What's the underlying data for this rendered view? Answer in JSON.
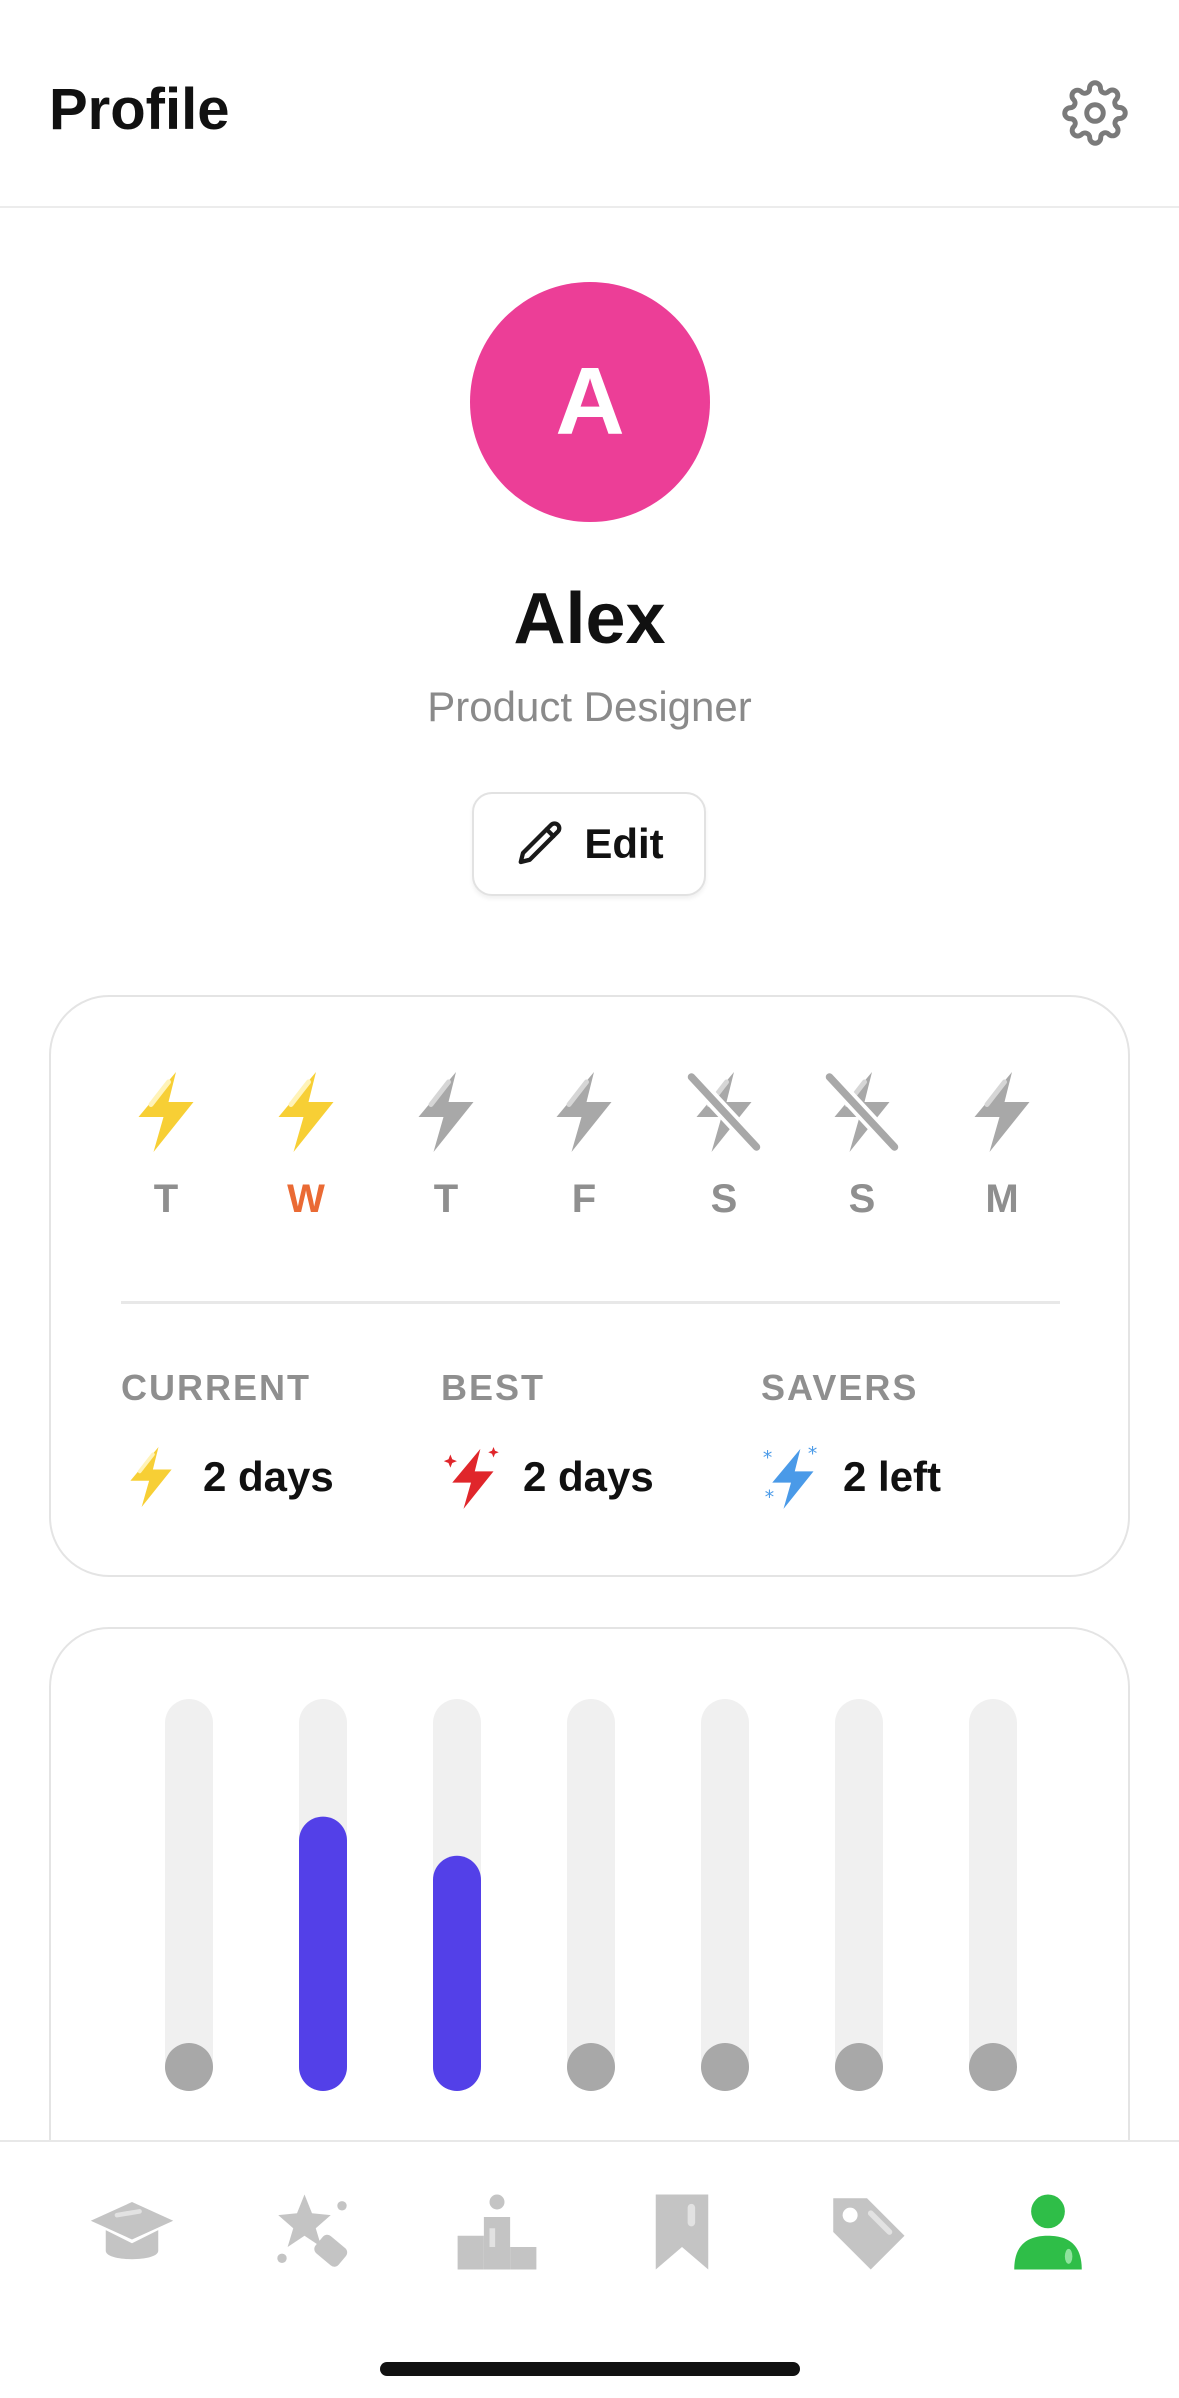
{
  "header": {
    "title": "Profile",
    "settings_icon": "gear-icon"
  },
  "profile": {
    "initial": "A",
    "name": "Alex",
    "role": "Product Designer",
    "avatar_color": "#ec3e97",
    "edit_label": "Edit"
  },
  "streak": {
    "days": [
      {
        "label": "T",
        "state": "active"
      },
      {
        "label": "W",
        "state": "active",
        "today": true
      },
      {
        "label": "T",
        "state": "inactive"
      },
      {
        "label": "F",
        "state": "inactive"
      },
      {
        "label": "S",
        "state": "frozen"
      },
      {
        "label": "S",
        "state": "frozen"
      },
      {
        "label": "M",
        "state": "inactive"
      }
    ],
    "stats": [
      {
        "label": "CURRENT",
        "value": "2 days",
        "icon": "bolt-yellow-icon"
      },
      {
        "label": "BEST",
        "value": "2 days",
        "icon": "bolt-red-sparkle-icon"
      },
      {
        "label": "SAVERS",
        "value": "2 left",
        "icon": "bolt-blue-snow-icon"
      }
    ],
    "colors": {
      "active": "#f7cf35",
      "inactive": "#a8a8a8",
      "today": "#ea6a34"
    }
  },
  "chart_data": {
    "type": "bar",
    "values": [
      0,
      0.7,
      0.6,
      0,
      0,
      0,
      0
    ],
    "ylim": [
      0,
      1
    ],
    "bar_color": "#5340e8",
    "track_color": "#f0f0f0",
    "empty_color": "#a8a8a8"
  },
  "tabbar": {
    "active_color": "#2fbe48",
    "inactive_color": "#c4c4c4",
    "items": [
      {
        "name": "learn",
        "icon": "graduation-cap-icon"
      },
      {
        "name": "practice",
        "icon": "sparkle-star-icon"
      },
      {
        "name": "leaderboard",
        "icon": "podium-icon"
      },
      {
        "name": "saved",
        "icon": "bookmark-icon"
      },
      {
        "name": "tags",
        "icon": "tag-icon"
      },
      {
        "name": "profile",
        "icon": "user-icon",
        "active": true
      }
    ]
  }
}
